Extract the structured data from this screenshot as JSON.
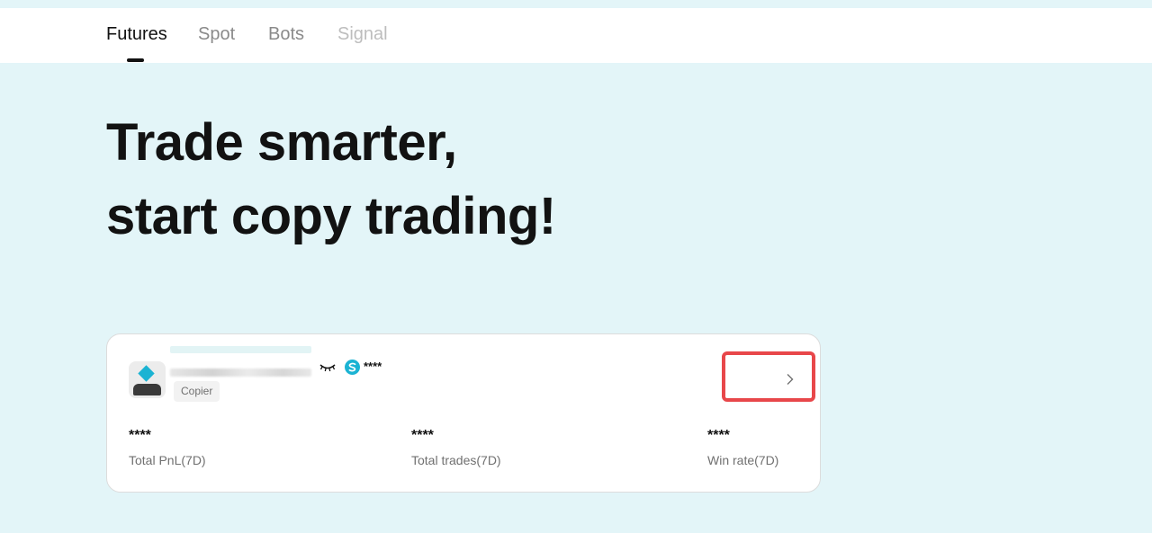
{
  "tabs": [
    {
      "label": "Futures",
      "state": "active"
    },
    {
      "label": "Spot",
      "state": "normal"
    },
    {
      "label": "Bots",
      "state": "normal"
    },
    {
      "label": "Signal",
      "state": "disabled"
    }
  ],
  "hero": {
    "line1": "Trade smarter,",
    "line2": "start copy trading!"
  },
  "card": {
    "avatar_icon": "avatar-placeholder",
    "visibility_icon": "eye-closed-icon",
    "coin_icon": "coin-icon",
    "masked_name": "****",
    "role_badge": "Copier",
    "detail_icon": "chevron-right-icon",
    "stats": [
      {
        "value": "****",
        "label": "Total PnL(7D)"
      },
      {
        "value": "****",
        "label": "Total trades(7D)"
      },
      {
        "value": "****",
        "label": "Win rate(7D)"
      }
    ]
  },
  "colors": {
    "background": "#e3f5f8",
    "accent": "#1bb3d3",
    "highlight": "#e8474a"
  }
}
